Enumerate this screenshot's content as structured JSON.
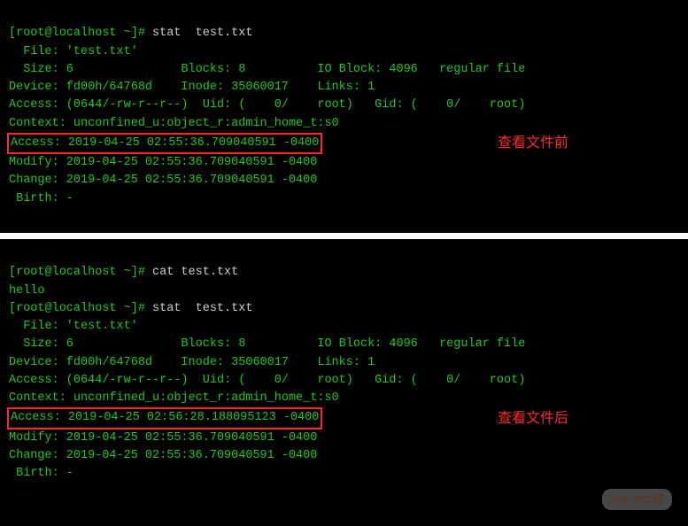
{
  "top": {
    "prompt": "[root@localhost ~]# ",
    "cmd1": "stat  test.txt",
    "l1": "  File: 'test.txt'",
    "l2": "  Size: 6               Blocks: 8          IO Block: 4096   regular file",
    "l3": "Device: fd00h/64768d    Inode: 35060017    Links: 1",
    "l4": "Access: (0644/-rw-r--r--)  Uid: (    0/    root)   Gid: (    0/    root)",
    "l5": "Context: unconfined_u:object_r:admin_home_t:s0",
    "l6": "Access: 2019-04-25 02:55:36.709040591 -0400",
    "l7": "Modify: 2019-04-25 02:55:36.709040591 -0400",
    "l8": "Change: 2019-04-25 02:55:36.709040591 -0400",
    "l9": " Birth: -",
    "cn_label": "查看文件前"
  },
  "bottom": {
    "prompt": "[root@localhost ~]# ",
    "cmd1": "cat test.txt",
    "out1": "hello",
    "cmd2": "stat  test.txt",
    "l1": "  File: 'test.txt'",
    "l2": "  Size: 6               Blocks: 8          IO Block: 4096   regular file",
    "l3": "Device: fd00h/64768d    Inode: 35060017    Links: 1",
    "l4": "Access: (0644/-rw-r--r--)  Uid: (    0/    root)   Gid: (    0/    root)",
    "l5": "Context: unconfined_u:object_r:admin_home_t:s0",
    "l6": "Access: 2019-04-25 02:56:28.188095123 -0400",
    "l7": "Modify: 2019-04-25 02:55:36.709040591 -0400",
    "l8": "Change: 2019-04-25 02:55:36.709040591 -0400",
    "l9": " Birth: -",
    "cn_label": "查看文件后",
    "watermark": "php 中文网"
  }
}
